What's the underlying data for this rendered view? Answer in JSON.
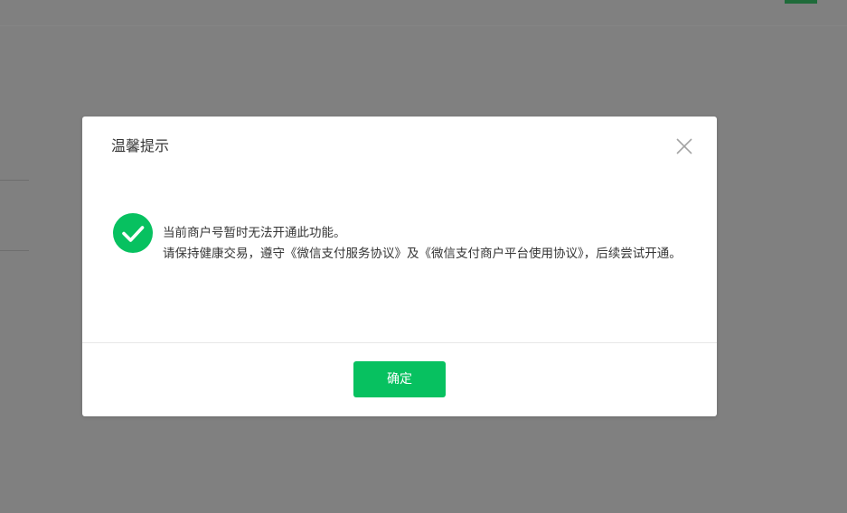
{
  "dialog": {
    "title": "温馨提示",
    "close_icon": "close-icon",
    "status_icon": "success-check-icon",
    "message_line1": "当前商户号暂时无法开通此功能。",
    "message_line2": "请保持健康交易，遵守《微信支付服务协议》及《微信支付商户平台使用协议》，后续尝试开通。",
    "confirm_label": "确定"
  },
  "colors": {
    "accent": "#07c160",
    "overlay": "#808080",
    "dialog_bg": "#ffffff",
    "text": "#353535",
    "background_tab_underline": "#1f6b3a"
  }
}
